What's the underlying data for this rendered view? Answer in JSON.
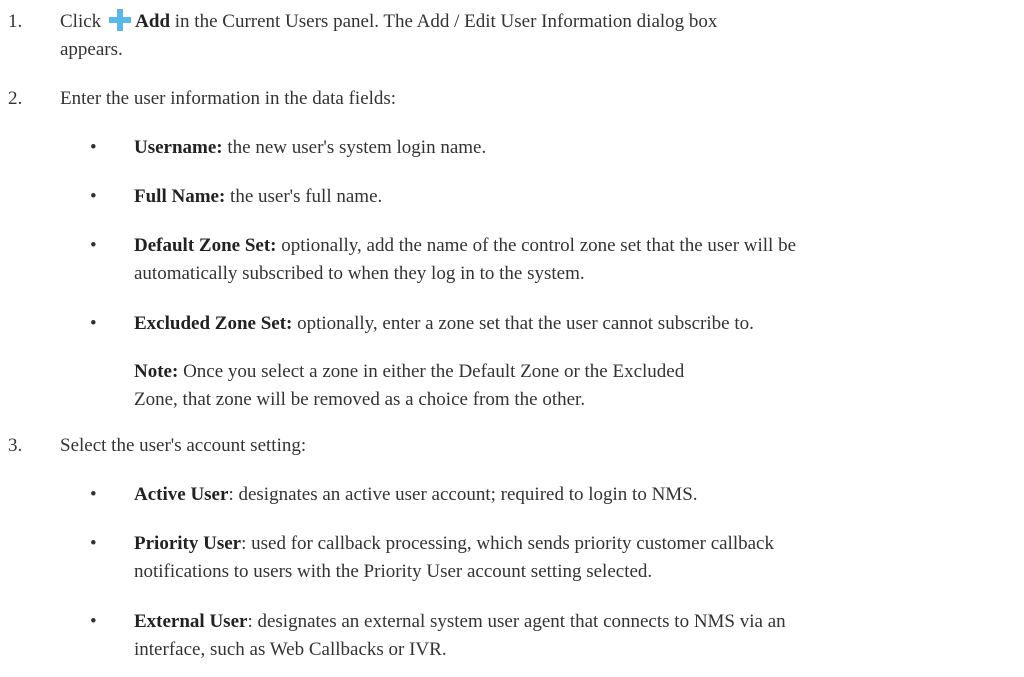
{
  "steps": [
    {
      "num": "1.",
      "pre": "Click",
      "icon": "plus-icon",
      "bold": "Add",
      "rest": " in the Current Users panel. The Add / Edit User Information dialog box",
      "cont": "appears."
    },
    {
      "num": "2.",
      "text": "Enter the user information in the data fields:"
    },
    {
      "num": "3.",
      "text": "Select the user's account setting:"
    }
  ],
  "fields": [
    {
      "bullet": "•",
      "term": "Username:",
      "desc": " the new user's system login name."
    },
    {
      "bullet": "•",
      "term": "Full Name:",
      "desc": " the user's full name."
    },
    {
      "bullet": "•",
      "term": "Default Zone Set:",
      "desc": " optionally, add the name of the control zone set that the user will be",
      "cont": "automatically subscribed to when they log in to the system."
    },
    {
      "bullet": "•",
      "term": "Excluded Zone Set:",
      "desc": " optionally, enter a zone set that the user cannot subscribe to."
    }
  ],
  "note": {
    "label": "Note:",
    "line1": " Once you select a zone in either the Default Zone or the Excluded",
    "line2": "Zone, that zone will be removed as a choice from the other."
  },
  "settings": [
    {
      "bullet": "•",
      "term": "Active User",
      "desc": ": designates an active user account; required to login to NMS."
    },
    {
      "bullet": "•",
      "term": "Priority User",
      "desc": ": used for callback processing, which sends priority customer callback",
      "cont": "notifications to users with the Priority User account setting selected."
    },
    {
      "bullet": "•",
      "term": "External User",
      "desc": ": designates an external system user agent that connects to NMS via an",
      "cont": "interface, such as Web Callbacks or IVR."
    }
  ]
}
